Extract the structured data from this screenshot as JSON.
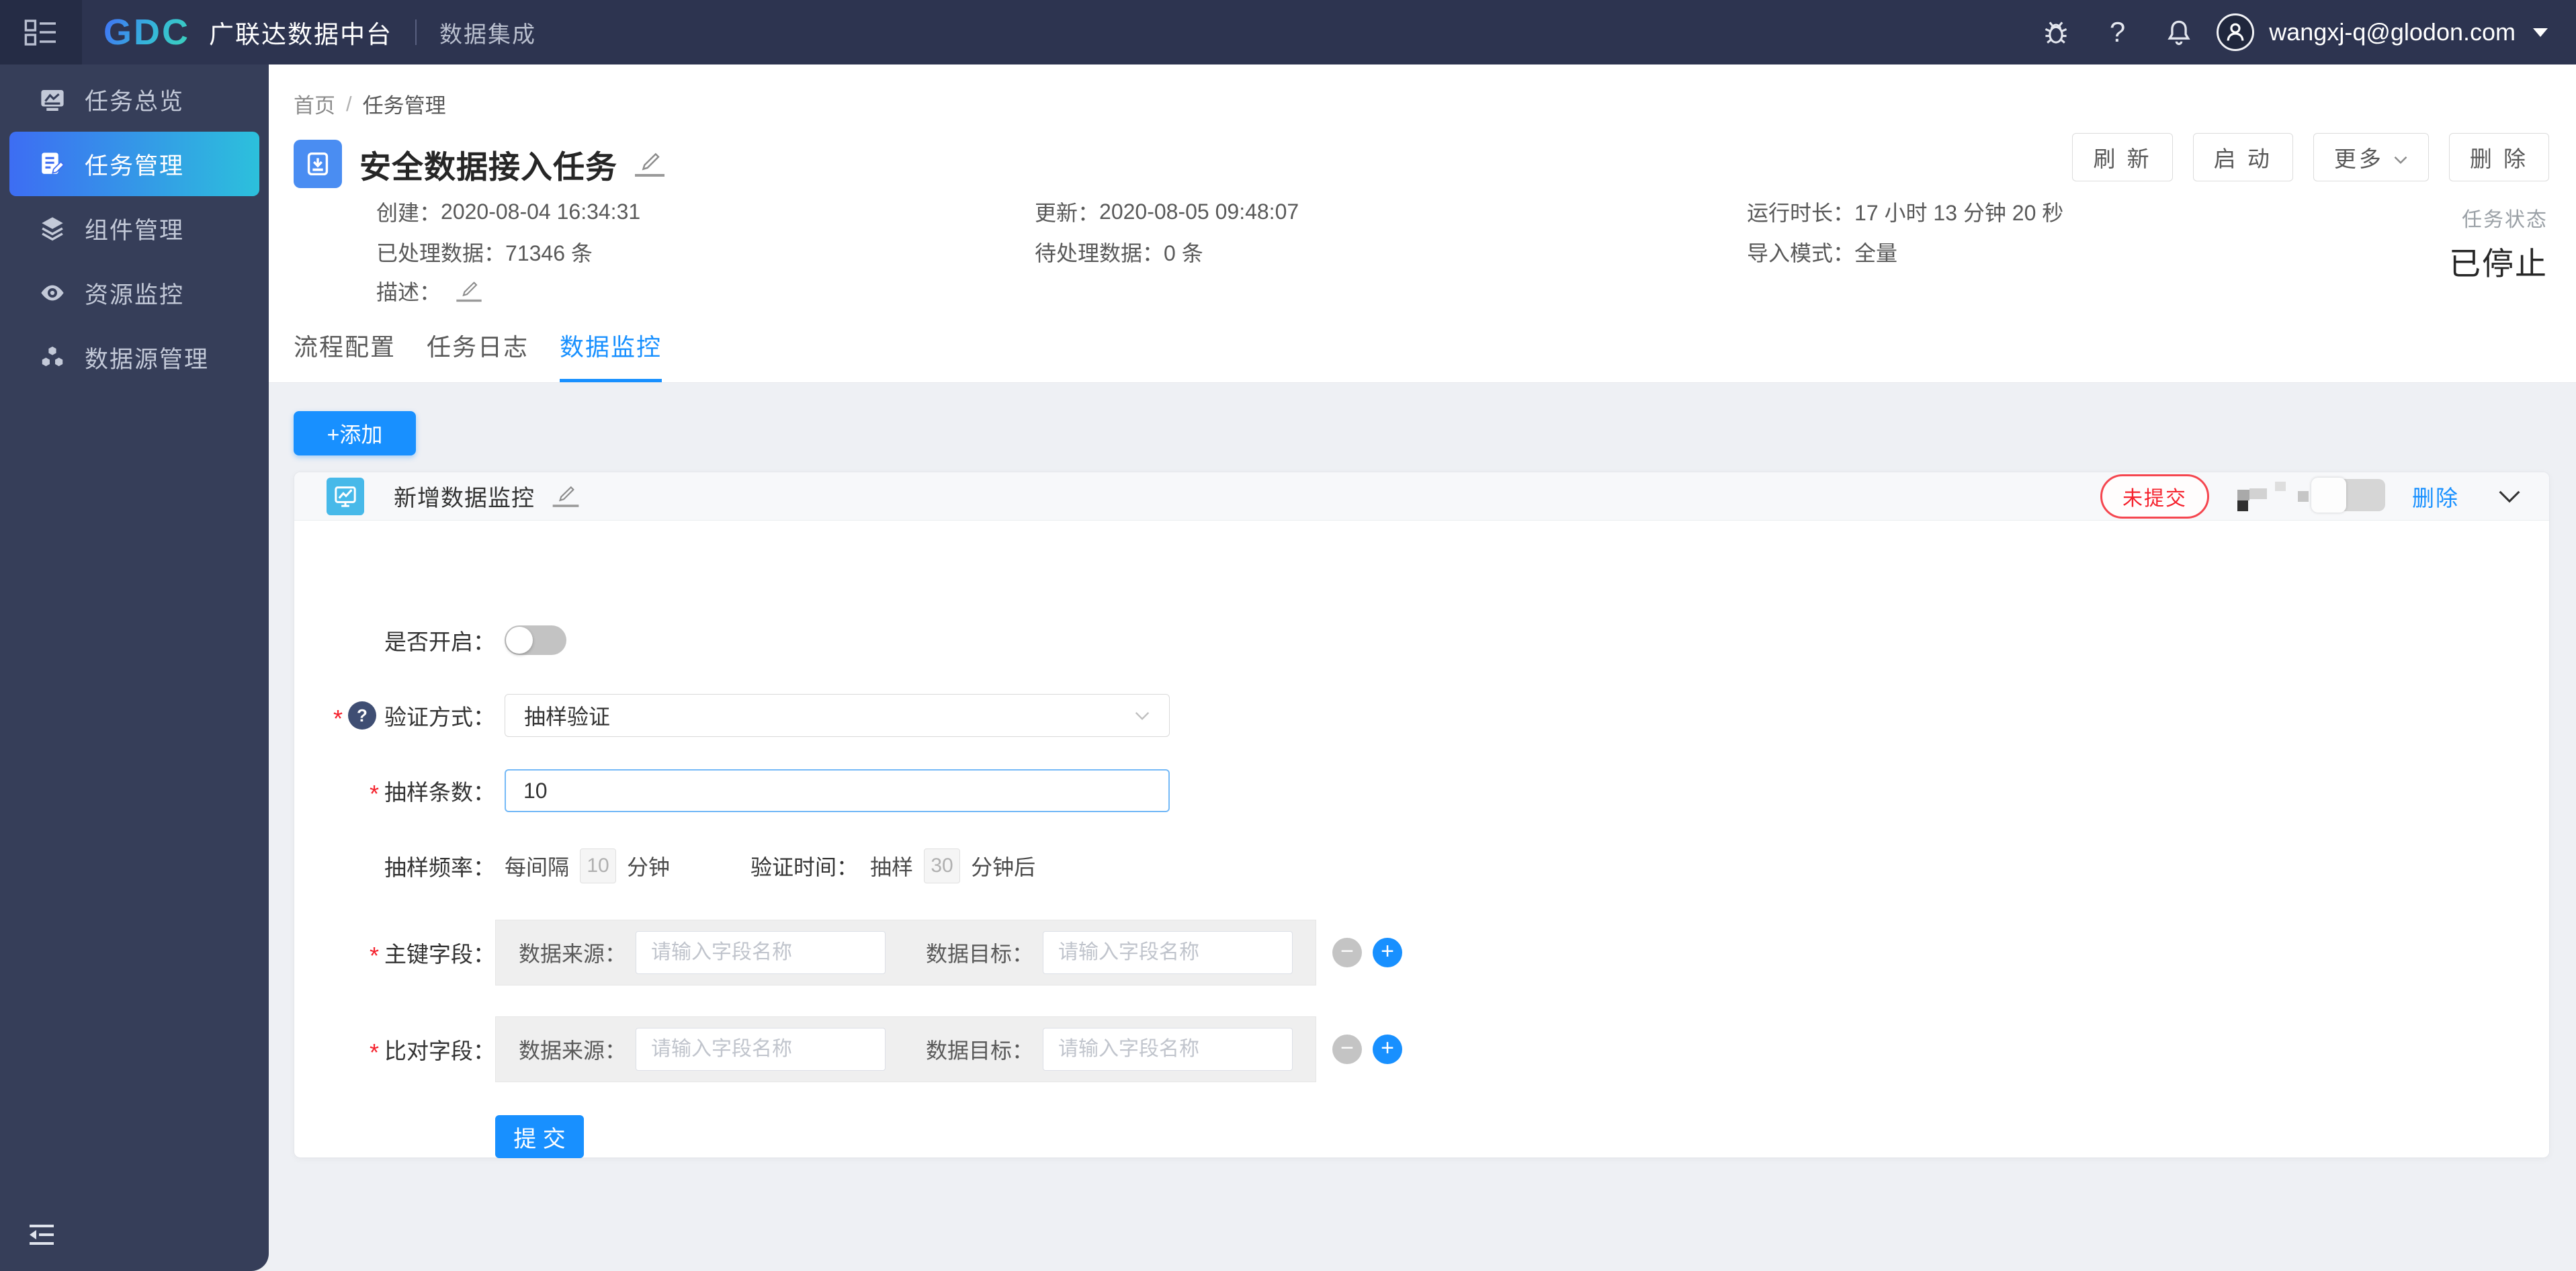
{
  "header": {
    "brand": "GDC",
    "product_name": "广联达数据中台",
    "module_name": "数据集成",
    "user_email": "wangxj-q@glodon.com",
    "help_glyph": "?"
  },
  "sidebar": {
    "items": [
      {
        "label": "任务总览",
        "icon": "dashboard-chart-icon",
        "active": false
      },
      {
        "label": "任务管理",
        "icon": "task-edit-icon",
        "active": true
      },
      {
        "label": "组件管理",
        "icon": "layers-icon",
        "active": false
      },
      {
        "label": "资源监控",
        "icon": "eye-icon",
        "active": false
      },
      {
        "label": "数据源管理",
        "icon": "datasource-icon",
        "active": false
      }
    ]
  },
  "breadcrumb": {
    "items": [
      "首页",
      "任务管理"
    ],
    "separator": "/"
  },
  "task": {
    "title": "安全数据接入任务",
    "actions": {
      "refresh": "刷 新",
      "start": "启 动",
      "more": "更多",
      "delete": "删 除"
    },
    "status_label": "任务状态",
    "status_value": "已停止",
    "info": {
      "created_label": "创建：",
      "created_value": "2020-08-04 16:34:31",
      "updated_label": "更新：",
      "updated_value": "2020-08-05 09:48:07",
      "runtime_label": "运行时长：",
      "runtime_value": "17 小时 13 分钟 20 秒",
      "processed_label": "已处理数据：",
      "processed_value": "71346 条",
      "pending_label": "待处理数据：",
      "pending_value": "0 条",
      "import_mode_label": "导入模式：",
      "import_mode_value": "全量",
      "description_label": "描述："
    }
  },
  "tabs": [
    {
      "label": "流程配置",
      "active": false
    },
    {
      "label": "任务日志",
      "active": false
    },
    {
      "label": "数据监控",
      "active": true
    }
  ],
  "monitor": {
    "add_button_label": "+添加",
    "card": {
      "title": "新增数据监控",
      "status_badge": "未提交",
      "delete_label": "删除",
      "form": {
        "required_mark": "*",
        "enabled_label": "是否开启：",
        "verify_method_label": "验证方式：",
        "verify_method_value": "抽样验证",
        "question_glyph": "?",
        "sample_count_label": "抽样条数：",
        "sample_count_value": "10",
        "sample_freq_label": "抽样频率：",
        "sample_freq_prefix": "每间隔",
        "sample_freq_value": "10",
        "sample_freq_unit": "分钟",
        "verify_time_label": "验证时间：",
        "verify_time_prefix": "抽样",
        "verify_time_value": "30",
        "verify_time_unit": "分钟后",
        "primary_field_label": "主键字段：",
        "compare_field_label": "比对字段：",
        "source_label": "数据来源：",
        "target_label": "数据目标：",
        "field_placeholder": "请输入字段名称",
        "minus_glyph": "−",
        "plus_glyph": "+",
        "submit_label": "提 交"
      }
    }
  },
  "colors": {
    "primary_blue": "#1890ff",
    "danger_red": "#f5222d",
    "sidebar_bg": "#363e59",
    "header_bg": "#2d3450",
    "active_gradient_start": "#3d6df3",
    "active_gradient_end": "#2cc0dc",
    "card_icon_bg": "#47b9e9",
    "title_icon_bg": "#4a8df2"
  }
}
